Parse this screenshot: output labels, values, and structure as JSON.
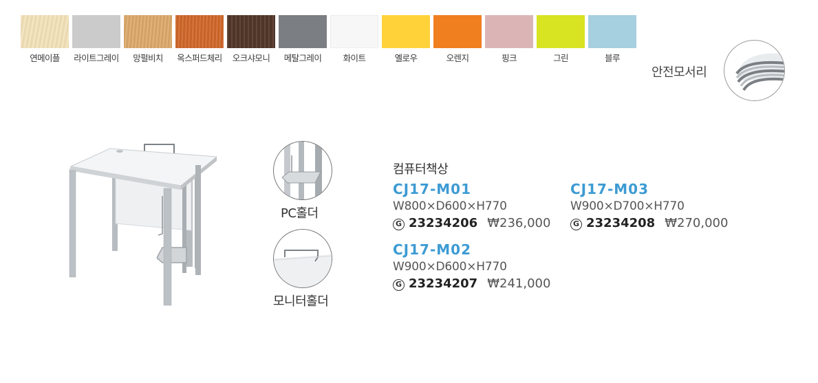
{
  "swatches": [
    {
      "label": "연메이플",
      "color": "#f1dfb6"
    },
    {
      "label": "라이트그레이",
      "color": "#cbcbcb"
    },
    {
      "label": "망펄비치",
      "color": "#ddaa6b"
    },
    {
      "label": "옥스퍼드체리",
      "color": "#d2692c"
    },
    {
      "label": "오크샤모니",
      "color": "#5a3c2e"
    },
    {
      "label": "메탈그레이",
      "color": "#7b7e82"
    },
    {
      "label": "화이트",
      "color": "#f7f7f7"
    },
    {
      "label": "옐로우",
      "color": "#ffd23a"
    },
    {
      "label": "오렌지",
      "color": "#f07f1f"
    },
    {
      "label": "핑크",
      "color": "#dbb5b5"
    },
    {
      "label": "그린",
      "color": "#d8e322"
    },
    {
      "label": "블루",
      "color": "#a6cfe0"
    }
  ],
  "safe_corner": {
    "label": "안전모서리"
  },
  "holders": {
    "pc_label": "PC홀더",
    "monitor_label": "모니터홀더"
  },
  "product": {
    "title": "컴퓨터책상",
    "models": [
      {
        "code": "CJ17-M01",
        "dims": "W800×D600×H770",
        "g_mark": "G",
        "gcode": "23234206",
        "price": "₩236,000"
      },
      {
        "code": "CJ17-M02",
        "dims": "W900×D600×H770",
        "g_mark": "G",
        "gcode": "23234207",
        "price": "₩241,000"
      },
      {
        "code": "CJ17-M03",
        "dims": "W900×D700×H770",
        "g_mark": "G",
        "gcode": "23234208",
        "price": "₩270,000"
      }
    ]
  }
}
